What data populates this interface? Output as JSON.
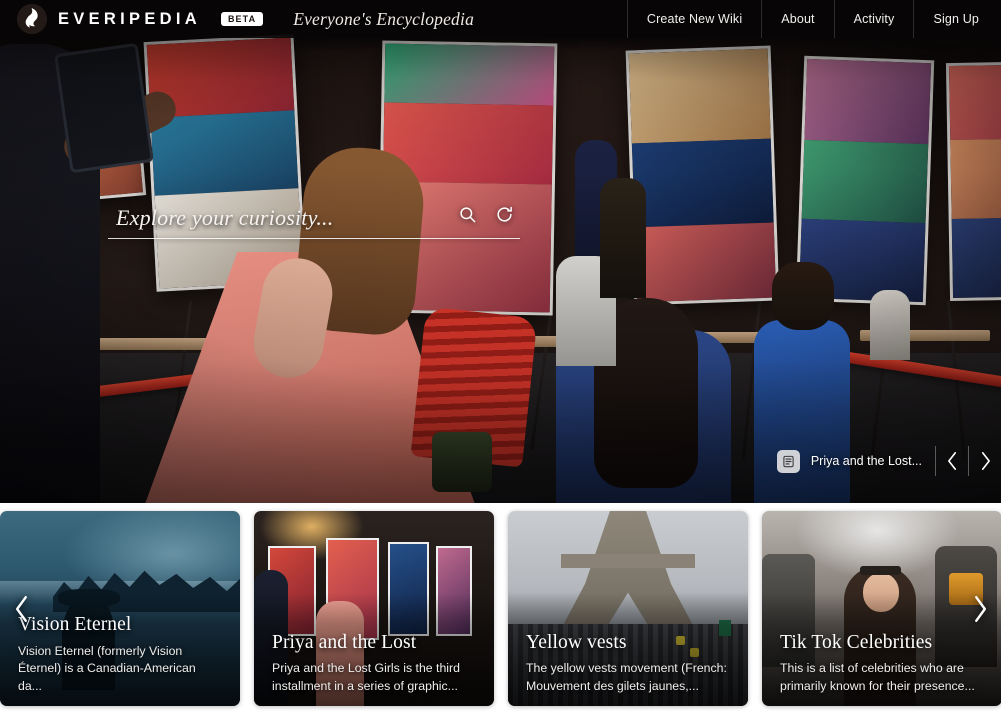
{
  "header": {
    "logo_icon": "everipedia-flame-logo",
    "wordmark": "EVERIPEDIA",
    "beta_badge": "BETA",
    "tagline": "Everyone's Encyclopedia",
    "nav": [
      {
        "label": "Create New Wiki"
      },
      {
        "label": "About"
      },
      {
        "label": "Activity"
      },
      {
        "label": "Sign Up"
      }
    ],
    "background_color": "#080505",
    "text_color": "#ffffff"
  },
  "hero": {
    "search": {
      "placeholder": "Explore your curiosity...",
      "value": "",
      "search_icon": "search-icon",
      "shuffle_icon": "refresh-icon"
    },
    "caption": {
      "article_icon": "article-list-icon",
      "title": "Priya and the Lost...",
      "prev_icon": "chevron-left-icon",
      "next_icon": "chevron-right-icon"
    }
  },
  "cards": {
    "prev_icon": "chevron-left-icon",
    "next_icon": "chevron-right-icon",
    "items": [
      {
        "title": "Vision Eternel",
        "description": "Vision Eternel (formerly Vision Éternel) is a Canadian-American da..."
      },
      {
        "title": "Priya and the Lost",
        "description": "Priya and the Lost Girls is the third installment in a series of graphic..."
      },
      {
        "title": "Yellow vests",
        "description": "The yellow vests movement (French: Mouvement des gilets jaunes,..."
      },
      {
        "title": "Tik Tok Celebrities",
        "description": "This is a list of celebrities who are primarily known for their presence..."
      }
    ]
  }
}
